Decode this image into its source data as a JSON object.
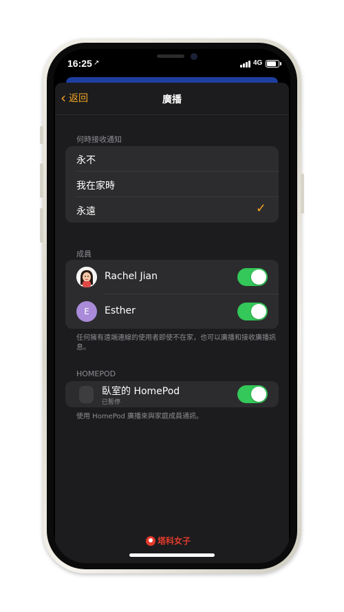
{
  "status_bar": {
    "time": "16:25",
    "location_arrow": "↗",
    "network": "4G"
  },
  "nav": {
    "back_label": "返回",
    "title": "廣播",
    "back_icon": "chevron-left-icon",
    "accent_color": "#f5a623"
  },
  "when_section": {
    "header": "何時接收通知",
    "options": [
      {
        "label": "永不",
        "selected": false
      },
      {
        "label": "我在家時",
        "selected": false
      },
      {
        "label": "永遠",
        "selected": true
      }
    ],
    "check_glyph": "✓"
  },
  "members_section": {
    "header": "成員",
    "members": [
      {
        "name": "Rachel Jian",
        "avatar": "memoji",
        "enabled": true
      },
      {
        "name": "Esther",
        "avatar_initial": "E",
        "enabled": true
      }
    ],
    "footer": "任何擁有遠端連線的使用者即使不在家，也可以廣播和接收廣播訊息。"
  },
  "homepod_section": {
    "header": "HOMEPOD",
    "device": {
      "name": "臥室的 HomePod",
      "status": "已暫停",
      "enabled": true
    },
    "footer": "使用 HomePod 廣播來與家庭成員通訊。"
  },
  "watermark": {
    "text": "塔科女子"
  },
  "colors": {
    "toggle_on": "#34c759",
    "sheet_bg": "#1c1c1e",
    "group_bg": "#2c2c2e"
  }
}
